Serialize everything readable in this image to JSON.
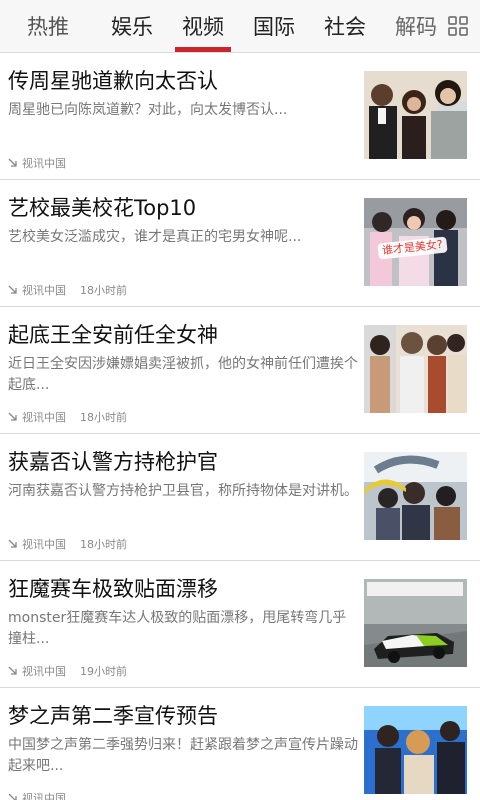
{
  "tabs": [
    "热推",
    "娱乐",
    "视频",
    "国际",
    "社会",
    "解码"
  ],
  "active_tab": "视频",
  "accent_color": "#c9252c",
  "grid_icon": "grid-icon",
  "news": [
    {
      "title": "传周星驰道歉向太否认",
      "summary": "周星驰已向陈岚道歉？对此，向太发博否认...",
      "source": "视讯中国",
      "time": ""
    },
    {
      "title": "艺校最美校花Top10",
      "summary": "艺校美女泛滥成灾，谁才是真正的宅男女神呢...",
      "source": "视讯中国",
      "time": "18小时前",
      "thumb_caption": "谁才是美女?"
    },
    {
      "title": "起底王全安前任全女神",
      "summary": "近日王全安因涉嫌嫖娼卖淫被抓，他的女神前任们遭挨个起底...",
      "source": "视讯中国",
      "time": "18小时前"
    },
    {
      "title": "获嘉否认警方持枪护官",
      "summary": "河南获嘉否认警方持枪护卫县官，称所持物体是对讲机。",
      "source": "视讯中国",
      "time": "18小时前"
    },
    {
      "title": "狂魔赛车极致贴面漂移",
      "summary": "monster狂魔赛车达人极致的贴面漂移，甩尾转弯几乎撞柱...",
      "source": "视讯中国",
      "time": "19小时前"
    },
    {
      "title": "梦之声第二季宣传预告",
      "summary": "中国梦之声第二季强势归来！赶紧跟着梦之声宣传片躁动起来吧...",
      "source": "视讯中国",
      "time": ""
    }
  ]
}
